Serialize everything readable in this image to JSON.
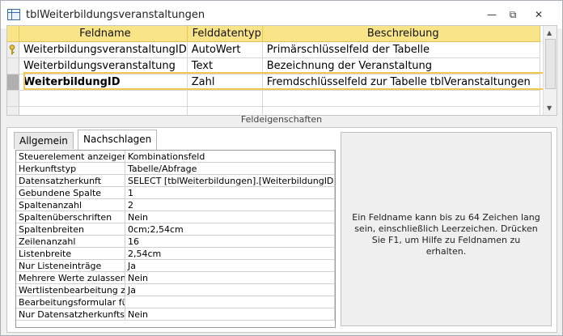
{
  "window": {
    "title": "tblWeiterbildungsveranstaltungen",
    "controls": {
      "minimize": "—",
      "restore": "⧉",
      "close": "✕"
    }
  },
  "grid": {
    "headers": [
      "Feldname",
      "Felddatentyp",
      "Beschreibung"
    ],
    "rows": [
      {
        "name": "WeiterbildungsveranstaltungID",
        "type": "AutoWert",
        "desc": "Primärschlüsselfeld der Tabelle"
      },
      {
        "name": "Weiterbildungsveranstaltung",
        "type": "Text",
        "desc": "Bezeichnung der Veranstaltung"
      },
      {
        "name": "WeiterbildungID",
        "type": "Zahl",
        "desc": "Fremdschlüsselfeld zur Tabelle tblVeranstaltungen"
      },
      {
        "name": "",
        "type": "",
        "desc": ""
      },
      {
        "name": "",
        "type": "",
        "desc": ""
      }
    ]
  },
  "section_label": "Feldeigenschaften",
  "tabs": {
    "general": "Allgemein",
    "lookup": "Nachschlagen"
  },
  "properties": [
    {
      "k": "Steuerelement anzeigen",
      "v": "Kombinationsfeld"
    },
    {
      "k": "Herkunftstyp",
      "v": "Tabelle/Abfrage"
    },
    {
      "k": "Datensatzherkunft",
      "v": "SELECT [tblWeiterbildungen].[WeiterbildungID], [t"
    },
    {
      "k": "Gebundene Spalte",
      "v": "1"
    },
    {
      "k": "Spaltenanzahl",
      "v": "2"
    },
    {
      "k": "Spaltenüberschriften",
      "v": "Nein"
    },
    {
      "k": "Spaltenbreiten",
      "v": "0cm;2,54cm"
    },
    {
      "k": "Zeilenanzahl",
      "v": "16"
    },
    {
      "k": "Listenbreite",
      "v": "2,54cm"
    },
    {
      "k": "Nur Listeneinträge",
      "v": "Ja"
    },
    {
      "k": "Mehrere Werte zulassen",
      "v": "Nein"
    },
    {
      "k": "Wertlistenbearbeitung zu",
      "v": "Ja"
    },
    {
      "k": "Bearbeitungsformular für",
      "v": ""
    },
    {
      "k": "Nur Datensatzherkunftsw",
      "v": "Nein"
    }
  ],
  "help_text": "Ein Feldname kann bis zu 64 Zeichen lang sein, einschließlich Leerzeichen. Drücken Sie F1, um Hilfe zu Feldnamen zu erhalten."
}
